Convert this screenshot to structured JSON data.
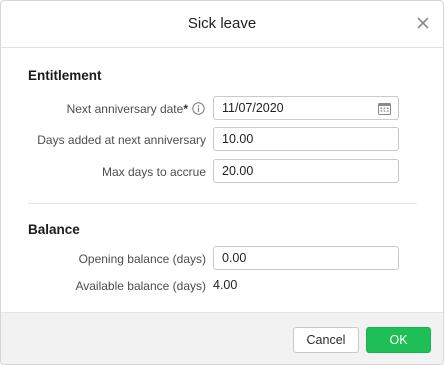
{
  "dialog": {
    "title": "Sick leave",
    "close_icon": "close-icon"
  },
  "entitlement": {
    "heading": "Entitlement",
    "next_anniversary": {
      "label": "Next anniversary date",
      "required_mark": "*",
      "info_icon": "info-icon",
      "value": "11/07/2020",
      "calendar_icon": "calendar-icon"
    },
    "days_added": {
      "label": "Days added at next anniversary",
      "value": "10.00"
    },
    "max_days": {
      "label": "Max days to accrue",
      "value": "20.00"
    }
  },
  "balance": {
    "heading": "Balance",
    "opening": {
      "label": "Opening balance (days)",
      "value": "0.00"
    },
    "available": {
      "label": "Available balance (days)",
      "value": "4.00"
    }
  },
  "footer": {
    "cancel_label": "Cancel",
    "ok_label": "OK"
  },
  "colors": {
    "ok_button": "#1fbf57",
    "footer_bg": "#f2f2f2"
  }
}
